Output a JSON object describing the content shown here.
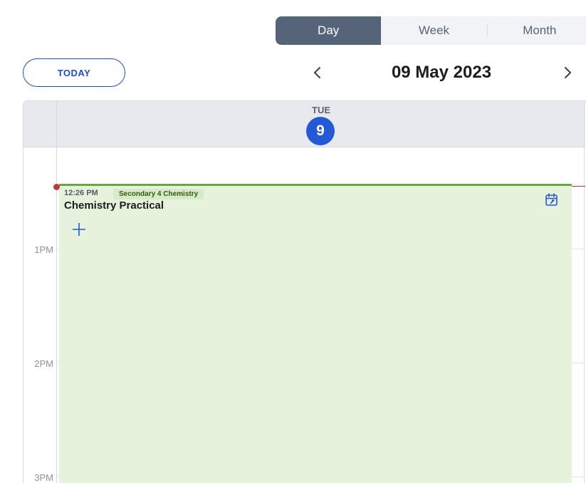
{
  "view_switcher": {
    "options": [
      {
        "label": "Day",
        "active": true
      },
      {
        "label": "Week",
        "active": false
      },
      {
        "label": "Month",
        "active": false
      }
    ]
  },
  "toolbar": {
    "today_label": "TODAY",
    "prev_icon": "chevron-left-icon",
    "next_icon": "chevron-right-icon",
    "date_title": "09 May 2023"
  },
  "day_header": {
    "weekday": "TUE",
    "day_number": "9"
  },
  "hours": [
    "1PM",
    "2PM",
    "3PM"
  ],
  "event": {
    "time": "12:26 PM",
    "tag": "Secondary 4 Chemistry",
    "title": "Chemistry Practical",
    "add_icon": "plus-icon",
    "calendar_icon": "calendar-export-icon"
  },
  "colors": {
    "accent": "#2459d6",
    "switch_active": "#56647a",
    "event_bg": "#e6f2dc",
    "event_border": "#6da544",
    "now_indicator": "#c0393b"
  }
}
